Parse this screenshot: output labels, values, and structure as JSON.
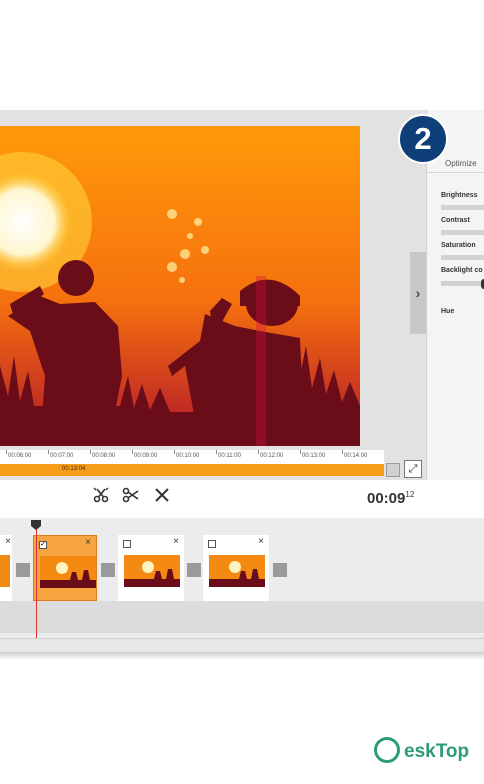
{
  "step_badge": "2",
  "panel": {
    "tab_label": "Optimize",
    "collapse_glyph": "›",
    "sliders": [
      {
        "label": "Brightness"
      },
      {
        "label": "Contrast"
      },
      {
        "label": "Saturation"
      },
      {
        "label": "Backlight co"
      },
      {
        "label": "Hue"
      }
    ]
  },
  "ruler": {
    "ticks": [
      "00:06:00",
      "00:07:00",
      "00:08:00",
      "00:09:00",
      "00:10:00",
      "00:11:00",
      "00:12:00",
      "00:13:00",
      "00:14:00"
    ]
  },
  "progress": {
    "time_label": "00:13:04"
  },
  "toolbar": {
    "split_icon": "split-scissors-icon",
    "cut_icon": "scissors-icon",
    "delete_icon": "delete-x-icon",
    "timecode_main": "00:09",
    "timecode_frames": "12"
  },
  "clips": [
    {
      "checked": false,
      "close": "×"
    },
    {
      "checked": true,
      "close": "×"
    },
    {
      "checked": false,
      "close": "×"
    },
    {
      "checked": false,
      "close": "×"
    }
  ],
  "expand_glyph": "⤢",
  "watermark": {
    "text": "eskTop"
  },
  "colors": {
    "accent_orange": "#f59c1a",
    "badge_blue": "#0e3f78",
    "watermark_green": "#2c9b7a"
  }
}
